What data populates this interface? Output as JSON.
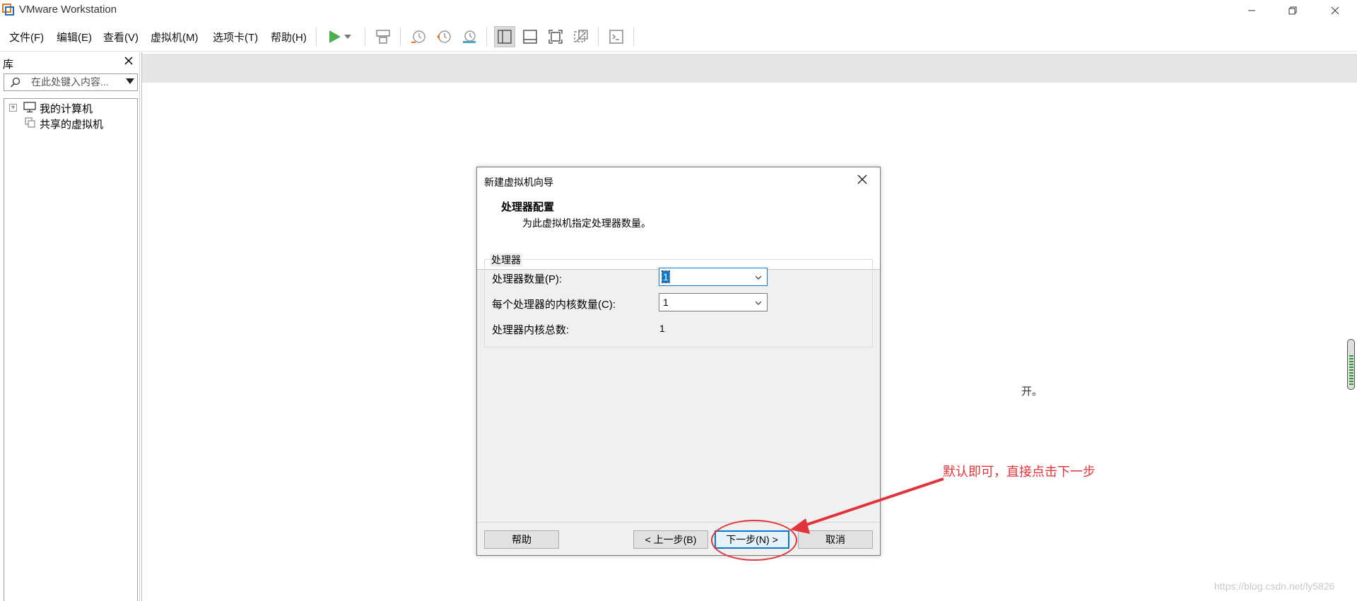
{
  "app": {
    "title": "VMware Workstation"
  },
  "menu": [
    "文件(F)",
    "编辑(E)",
    "查看(V)",
    "虚拟机(M)",
    "选项卡(T)",
    "帮助(H)"
  ],
  "toolbar": {
    "icons": [
      "play-icon",
      "dropdown-arrow-icon",
      "send-ctrl-alt-del-icon",
      "snapshot-icon",
      "revert-snapshot-icon",
      "snapshot-manager-icon",
      "library-view-icon",
      "thumbnail-bar-icon",
      "fullscreen-icon",
      "unity-icon",
      "console-view-icon"
    ],
    "colors": {
      "play": "#4caf50"
    }
  },
  "library": {
    "title": "库",
    "search_placeholder": "在此处键入内容...",
    "tree": [
      {
        "label": "我的计算机",
        "icon": "computer-icon",
        "expandable": true
      },
      {
        "label": "共享的虚拟机",
        "icon": "shared-vm-icon",
        "expandable": false
      }
    ]
  },
  "main": {
    "partial_text": "开。"
  },
  "dialog": {
    "title": "新建虚拟机向导",
    "header_title": "处理器配置",
    "header_subtitle": "为此虚拟机指定处理器数量。",
    "group_label": "处理器",
    "processor_count_label": "处理器数量(P):",
    "processor_count_value": "1",
    "cores_per_processor_label": "每个处理器的内核数量(C):",
    "cores_per_processor_value": "1",
    "total_cores_label": "处理器内核总数:",
    "total_cores_value": "1",
    "buttons": {
      "help": "帮助",
      "back": "< 上一步(B)",
      "next": "下一步(N) >",
      "cancel": "取消"
    }
  },
  "annotation": {
    "text": "默认即可，直接点击下一步",
    "color": "#e2333a"
  },
  "watermark": "https://blog.csdn.net/ly5826"
}
